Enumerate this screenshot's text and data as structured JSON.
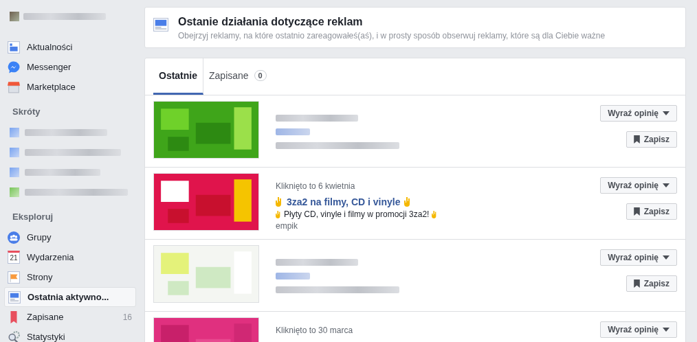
{
  "sidebar": {
    "main_items": [
      {
        "label": "Aktualności",
        "kind": "news",
        "selected": false
      },
      {
        "label": "Messenger",
        "kind": "messenger",
        "selected": false
      },
      {
        "label": "Marketplace",
        "kind": "shop",
        "selected": false
      }
    ],
    "shortcuts_heading": "Skróty",
    "explore_heading": "Eksploruj",
    "explore_items": [
      {
        "label": "Grupy",
        "kind": "groups",
        "selected": false
      },
      {
        "label": "Wydarzenia",
        "kind": "calendar",
        "day": "21",
        "selected": false
      },
      {
        "label": "Strony",
        "kind": "flag",
        "selected": false
      },
      {
        "label": "Ostatnia aktywno...",
        "kind": "monitor",
        "selected": true
      },
      {
        "label": "Zapisane",
        "kind": "bookmark",
        "count": "16",
        "selected": false
      },
      {
        "label": "Statystyki",
        "kind": "gear",
        "selected": false
      }
    ]
  },
  "header": {
    "title": "Ostanie działania dotyczące reklam",
    "subtitle": "Obejrzyj reklamy, na które ostatnio zareagowałeś(aś), i w prosty sposób obserwuj reklamy, które są dla Ciebie ważne"
  },
  "tabs": [
    {
      "label": "Ostatnie",
      "selected": true
    },
    {
      "label": "Zapisane",
      "count": "0",
      "selected": false
    }
  ],
  "ads": [
    {
      "kind": "blurred",
      "save": "Zapisz",
      "feedback": "Wyraź opinię"
    },
    {
      "kind": "visible",
      "clicked": "Kliknięto to 6 kwietnia",
      "title": "3za2 na filmy, CD i vinyle",
      "text": "Płyty CD, vinyle i filmy w promocji 3za2!",
      "source": "empik",
      "save": "Zapisz",
      "feedback": "Wyraź opinię"
    },
    {
      "kind": "blurred",
      "save": "Zapisz",
      "feedback": "Wyraź opinię"
    },
    {
      "kind": "visible",
      "clicked": "Kliknięto to 30 marca",
      "feedback": "Wyraź opinię"
    }
  ]
}
